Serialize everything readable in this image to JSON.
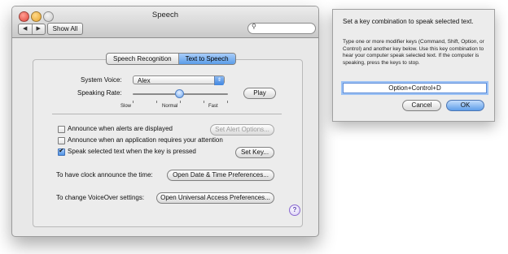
{
  "window": {
    "title": "Speech",
    "nav_back": "◀",
    "nav_forward": "▶",
    "show_all": "Show All",
    "search_placeholder": "",
    "search_icon": "magnifier-icon"
  },
  "tabs": [
    {
      "label": "Speech Recognition",
      "selected": false
    },
    {
      "label": "Text to Speech",
      "selected": true
    }
  ],
  "tts": {
    "system_voice_label": "System Voice:",
    "system_voice_value": "Alex",
    "speaking_rate_label": "Speaking Rate:",
    "rate_slow": "Slow",
    "rate_normal": "Normal",
    "rate_fast": "Fast",
    "rate_value_fraction": 0.49,
    "play_button": "Play"
  },
  "options": {
    "announce_alerts": {
      "label": "Announce when alerts are displayed",
      "checked": false
    },
    "set_alert_options": "Set Alert Options...",
    "announce_attention": {
      "label": "Announce when an application requires your attention",
      "checked": false
    },
    "speak_selected": {
      "label": "Speak selected text when the key is pressed",
      "checked": true
    },
    "set_key": "Set Key...",
    "clock_label": "To have clock announce the time:",
    "clock_button": "Open Date & Time Preferences...",
    "voiceover_label": "To change VoiceOver settings:",
    "voiceover_button": "Open Universal Access Preferences...",
    "help": "?"
  },
  "sheet": {
    "heading": "Set a key combination to speak selected text.",
    "body": "Type one or more modifier keys (Command, Shift, Option, or Control) and another key below. Use this key combination to hear your computer speak selected text. If the computer is speaking, press the keys to stop.",
    "key_value": "Option+Control+D",
    "cancel": "Cancel",
    "ok": "OK"
  },
  "colors": {
    "accent": "#5b9de8",
    "window_bg": "#e8e8e8",
    "close": "#e0443a",
    "minimize": "#e7a52e"
  }
}
